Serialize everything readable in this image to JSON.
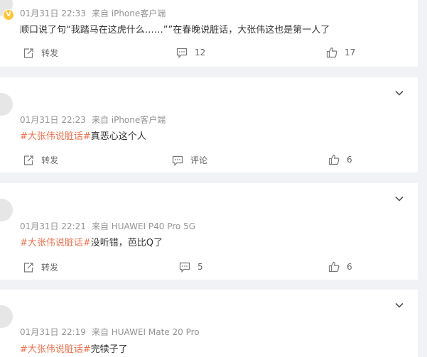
{
  "comments": [
    {
      "username": "",
      "time": "01月31日 22:33",
      "source": "来自 iPhone客户端",
      "tag": "",
      "text": "顺口说了句“我踏马在这虎什么……””在春晚说脏话，大张伟这也是第一人了",
      "repost_label": "转发",
      "comment_count": "12",
      "like_count": "17"
    },
    {
      "username": "",
      "time": "01月31日 22:23",
      "source": "来自 iPhone客户端",
      "tag": "#大张伟说脏话#",
      "text": "真恶心这个人",
      "repost_label": "转发",
      "comment_count": "评论",
      "like_count": "6"
    },
    {
      "username": "",
      "time": "01月31日 22:21",
      "source": "来自 HUAWEI P40 Pro 5G",
      "tag": "#大张伟说脏话#",
      "text": "没听错，芭比Q了",
      "repost_label": "转发",
      "comment_count": "5",
      "like_count": "6"
    },
    {
      "username": "",
      "time": "01月31日 22:19",
      "source": "来自 HUAWEI Mate 20 Pro",
      "tag": "#大张伟说脏话#",
      "text": "完犊子了"
    }
  ],
  "colors": {
    "background": "#f1f2f5",
    "tag": "#eb7350",
    "meta": "#939393",
    "vip": "#ffc53a"
  },
  "icons": [
    "repost-icon",
    "comment-icon",
    "like-icon",
    "chevron-down-icon",
    "vip-badge-icon"
  ]
}
